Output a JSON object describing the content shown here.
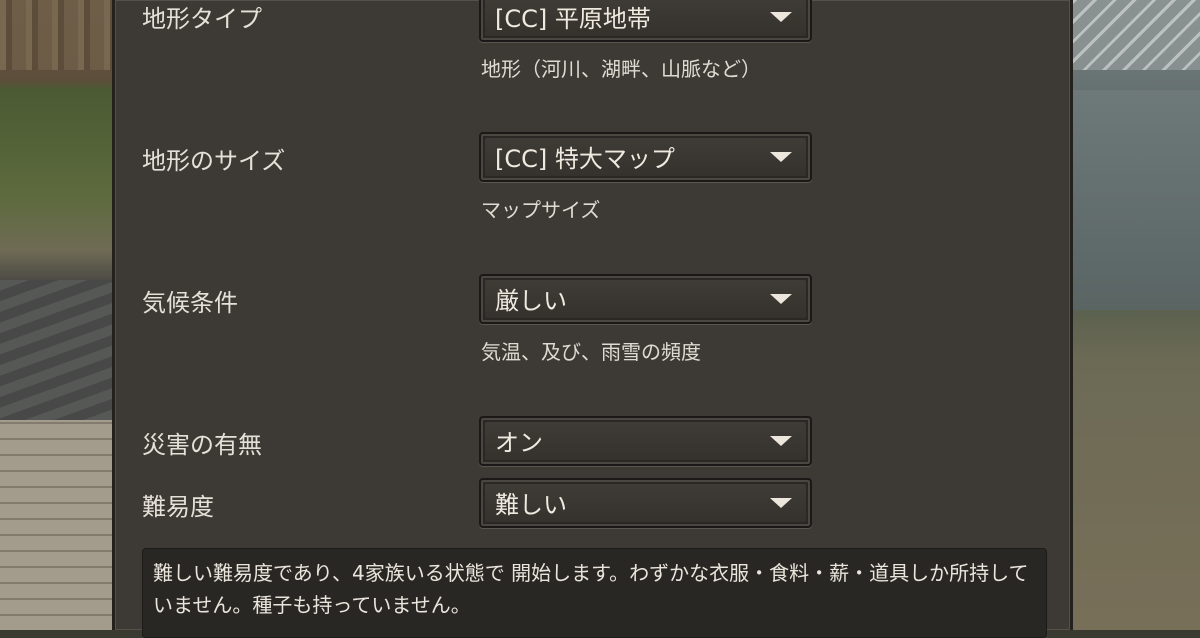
{
  "settings": [
    {
      "label": "地形タイプ",
      "value": "[CC] 平原地帯",
      "help": "地形（河川、湖畔、山脈など）"
    },
    {
      "label": "地形のサイズ",
      "value": "[CC] 特大マップ",
      "help": "マップサイズ"
    },
    {
      "label": "気候条件",
      "value": "厳しい",
      "help": "気温、及び、雨雪の頻度"
    },
    {
      "label": "災害の有無",
      "value": "オン",
      "help": ""
    },
    {
      "label": "難易度",
      "value": "難しい",
      "help": ""
    }
  ],
  "description": "難しい難易度であり、4家族いる状態で 開始します。わずかな衣服・食料・薪・道具しか所持していません。種子も持っていません。",
  "icons": {
    "dropdown": "chevron-down-icon"
  },
  "colors": {
    "panel_bg": "#3d3a35",
    "text": "#e6e1d8",
    "dropdown_bg": "#3f3b36"
  }
}
